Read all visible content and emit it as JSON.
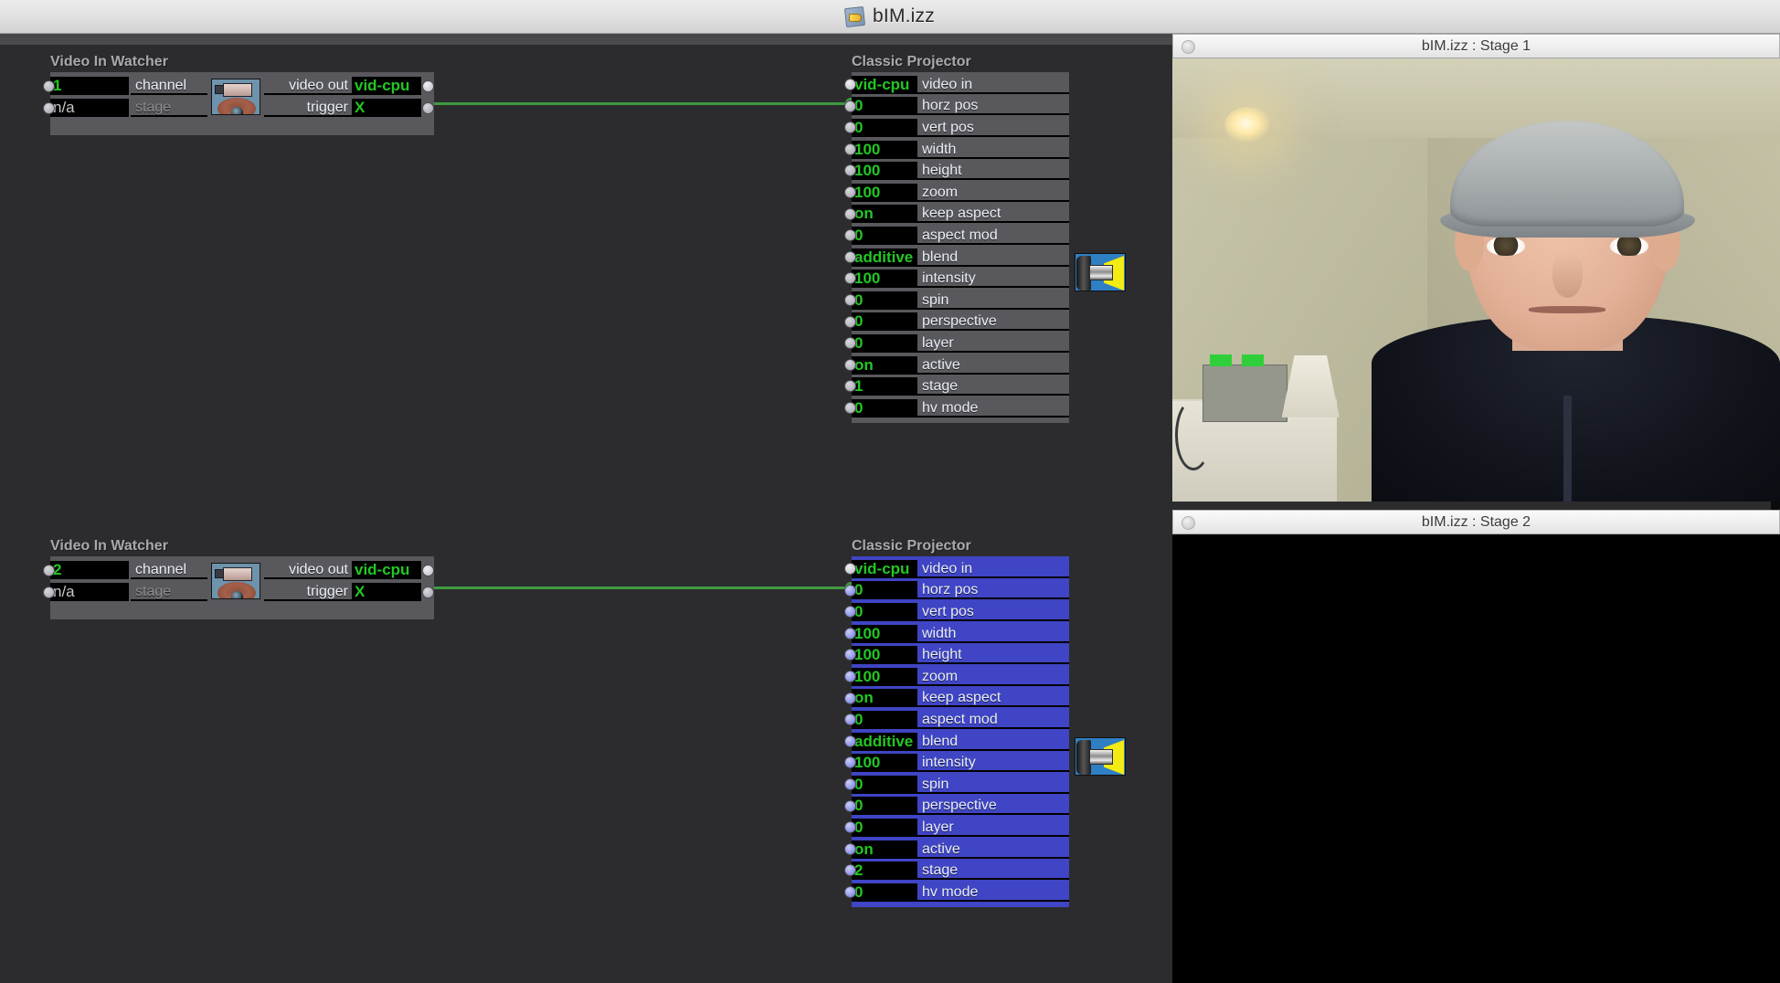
{
  "window": {
    "title": "bIM.izz",
    "doc_icon": "izzy-document-icon"
  },
  "patch": {
    "nodes": [
      {
        "id": "video-in-watcher-1",
        "type": "Video In Watcher",
        "title": "Video In Watcher",
        "icon": "camcorder-eye-icon",
        "inputs": [
          {
            "label": "channel",
            "value": "1",
            "enabled": true
          },
          {
            "label": "stage",
            "value": "n/a",
            "enabled": false
          }
        ],
        "outputs": [
          {
            "label": "video out",
            "value": "vid-cpu"
          },
          {
            "label": "trigger",
            "value": "X"
          }
        ]
      },
      {
        "id": "classic-projector-1",
        "type": "Classic Projector",
        "title": "Classic Projector",
        "icon": "projector-icon",
        "selected": false,
        "params": [
          {
            "label": "video in",
            "value": "vid-cpu"
          },
          {
            "label": "horz pos",
            "value": "0"
          },
          {
            "label": "vert pos",
            "value": "0"
          },
          {
            "label": "width",
            "value": "100"
          },
          {
            "label": "height",
            "value": "100"
          },
          {
            "label": "zoom",
            "value": "100"
          },
          {
            "label": "keep aspect",
            "value": "on"
          },
          {
            "label": "aspect mod",
            "value": "0"
          },
          {
            "label": "blend",
            "value": "additive"
          },
          {
            "label": "intensity",
            "value": "100"
          },
          {
            "label": "spin",
            "value": "0"
          },
          {
            "label": "perspective",
            "value": "0"
          },
          {
            "label": "layer",
            "value": "0"
          },
          {
            "label": "active",
            "value": "on"
          },
          {
            "label": "stage",
            "value": "1"
          },
          {
            "label": "hv mode",
            "value": "0"
          }
        ]
      },
      {
        "id": "video-in-watcher-2",
        "type": "Video In Watcher",
        "title": "Video In Watcher",
        "icon": "camcorder-eye-icon",
        "inputs": [
          {
            "label": "channel",
            "value": "2",
            "enabled": true
          },
          {
            "label": "stage",
            "value": "n/a",
            "enabled": false
          }
        ],
        "outputs": [
          {
            "label": "video out",
            "value": "vid-cpu"
          },
          {
            "label": "trigger",
            "value": "X"
          }
        ]
      },
      {
        "id": "classic-projector-2",
        "type": "Classic Projector",
        "title": "Classic Projector",
        "icon": "projector-icon",
        "selected": true,
        "params": [
          {
            "label": "video in",
            "value": "vid-cpu"
          },
          {
            "label": "horz pos",
            "value": "0"
          },
          {
            "label": "vert pos",
            "value": "0"
          },
          {
            "label": "width",
            "value": "100"
          },
          {
            "label": "height",
            "value": "100"
          },
          {
            "label": "zoom",
            "value": "100"
          },
          {
            "label": "keep aspect",
            "value": "on"
          },
          {
            "label": "aspect mod",
            "value": "0"
          },
          {
            "label": "blend",
            "value": "additive"
          },
          {
            "label": "intensity",
            "value": "100"
          },
          {
            "label": "spin",
            "value": "0"
          },
          {
            "label": "perspective",
            "value": "0"
          },
          {
            "label": "layer",
            "value": "0"
          },
          {
            "label": "active",
            "value": "on"
          },
          {
            "label": "stage",
            "value": "2"
          },
          {
            "label": "hv mode",
            "value": "0"
          }
        ]
      }
    ],
    "edge_port_count": 6,
    "colors": {
      "canvas_bg": "#2c2c2e",
      "node_bg": "#58585d",
      "node_bg_selected": "#3f45c4",
      "value_text": "#23c723",
      "label_text": "#e9eef5",
      "cable": "#3f9a3f",
      "title_text": "#a9a9ad"
    }
  },
  "stages": [
    {
      "id": "stage-1",
      "title": "bIM.izz : Stage 1",
      "content": "live-webcam-feed",
      "description": "Man wearing a grey flat cap and dark navy fleece facing the camera in a room with pale olive walls, a recessed ceiling light at upper left and a dresser with boxes and a lampshade at lower left."
    },
    {
      "id": "stage-2",
      "title": "bIM.izz : Stage 2",
      "content": "black-output",
      "description": "Empty black stage output."
    }
  ]
}
